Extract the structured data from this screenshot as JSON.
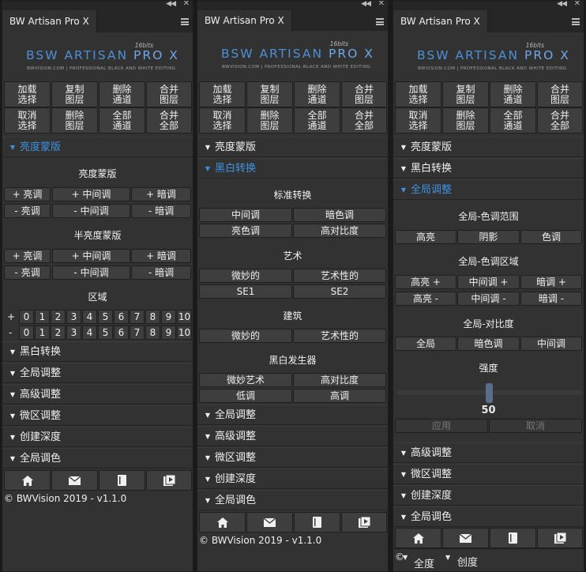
{
  "panel_title": "BW Artisan Pro X",
  "logo": {
    "main_a": "BSW ARTISAN ",
    "main_b": "PRO X",
    "sub": "BWVISION.COM | PROFESSIONAL BLACK AND WHITE EDITING",
    "badge": "16bits"
  },
  "top_buttons": [
    "加载\n选择",
    "复制\n图层",
    "删除\n通道",
    "合并\n图层",
    "取消\n选择",
    "删除\n图层",
    "全部\n通道",
    "合并\n全部"
  ],
  "sections": {
    "luminosity": "亮度蒙版",
    "bw_convert": "黑白转换",
    "global_adjust": "全局调整",
    "advanced_adjust": "高级调整",
    "micro_adjust": "微区调整",
    "create_depth": "创建深度",
    "global_toning": "全局调色"
  },
  "luminosity_panel": {
    "title_full": "亮度蒙版",
    "title_half": "半亮度蒙版",
    "plus_row": [
      "+ 亮调",
      "+ 中间调",
      "+ 暗调"
    ],
    "minus_row": [
      "- 亮调",
      "- 中间调",
      "- 暗调"
    ],
    "zone_title": "区域",
    "plus": "+",
    "minus": "-",
    "zones": [
      "0",
      "1",
      "2",
      "3",
      "4",
      "5",
      "6",
      "7",
      "8",
      "9",
      "10"
    ]
  },
  "bw_panel": {
    "standard_title": "标准转换",
    "standard": [
      "中间调",
      "暗色调",
      "亮色调",
      "高对比度"
    ],
    "art_title": "艺术",
    "art": [
      "微妙的",
      "艺术性的",
      "SE1",
      "SE2"
    ],
    "arch_title": "建筑",
    "arch": [
      "微妙的",
      "艺术性的"
    ],
    "gen_title": "黑白发生器",
    "gen": [
      "微妙艺术",
      "高对比度",
      "低调",
      "高调"
    ]
  },
  "global_panel": {
    "range_title": "全局-色调范围",
    "range": [
      "高亮",
      "阴影",
      "色调"
    ],
    "zone_title": "全局-色调区域",
    "zone_plus": [
      "高亮 +",
      "中间调 +",
      "暗调 +"
    ],
    "zone_minus": [
      "高亮 -",
      "中间调 -",
      "暗调 -"
    ],
    "contrast_title": "全局-对比度",
    "contrast": [
      "全局",
      "暗色调",
      "中间调"
    ],
    "strength_title": "强度",
    "strength_value": "50",
    "apply": "应用",
    "cancel": "取消"
  },
  "footer": "© BWVision 2019 - v1.1.0",
  "overlay_menu": [
    "全度",
    "创度"
  ],
  "colors": {
    "accent": "#3e92e0",
    "panel": "#323232",
    "button": "#3e3e3e"
  },
  "icons": [
    "home-icon",
    "mail-icon",
    "book-icon",
    "video-icon"
  ]
}
